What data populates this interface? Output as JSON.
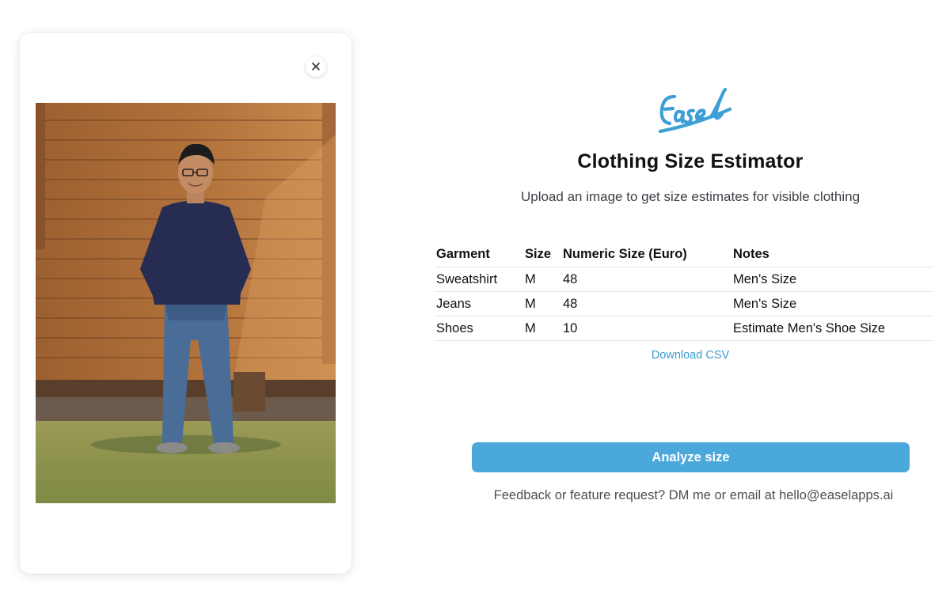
{
  "app": {
    "logo_text": "Easel",
    "title": "Clothing Size Estimator",
    "subtitle": "Upload an image to get size estimates for visible clothing"
  },
  "upload": {
    "close_icon": "close-icon",
    "image_icon": "uploaded-photo"
  },
  "table": {
    "headers": [
      "Garment",
      "Size",
      "Numeric Size (Euro)",
      "Notes"
    ],
    "rows": [
      {
        "garment": "Sweatshirt",
        "size": "M",
        "numeric": "48",
        "notes": "Men's Size"
      },
      {
        "garment": "Jeans",
        "size": "M",
        "numeric": "48",
        "notes": "Men's Size"
      },
      {
        "garment": "Shoes",
        "size": "M",
        "numeric": "10",
        "notes": "Estimate Men's Shoe Size"
      }
    ]
  },
  "actions": {
    "download_label": "Download CSV",
    "analyze_label": "Analyze size"
  },
  "footer": {
    "feedback": "Feedback or feature request? DM me or email at hello@easelapps.ai"
  },
  "colors": {
    "accent": "#4ba8db",
    "link": "#3a9bd1",
    "logo": "#3d9fd4"
  }
}
